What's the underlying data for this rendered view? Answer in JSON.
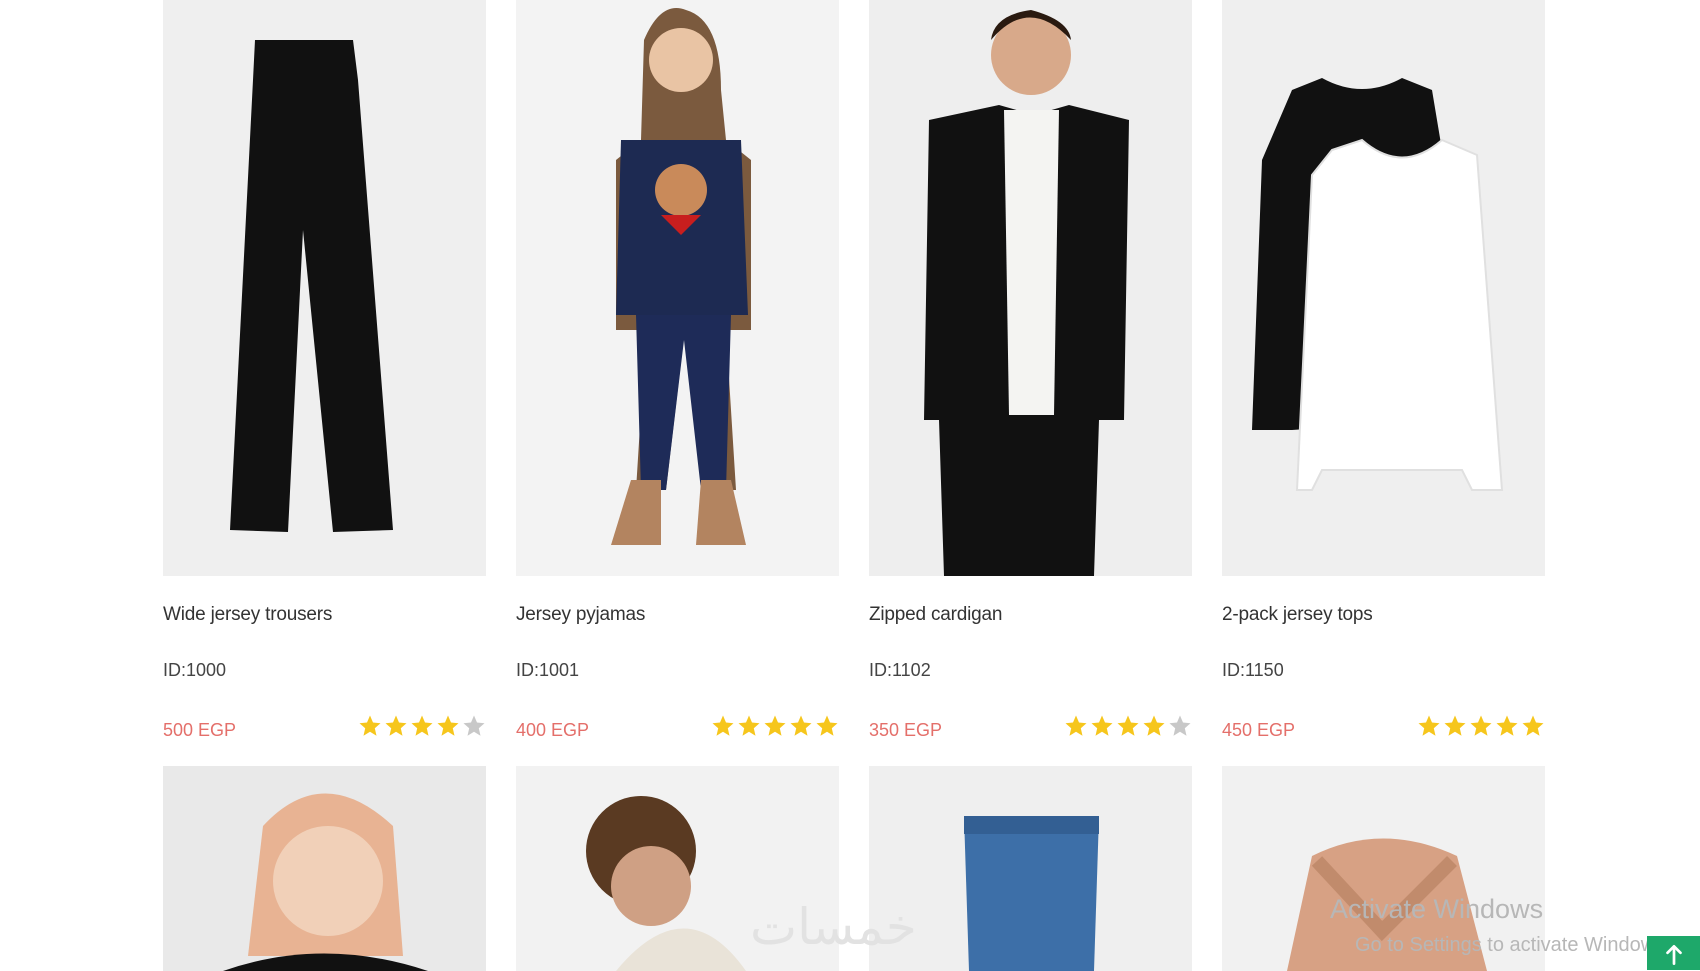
{
  "products_row1": [
    {
      "name": "Wide jersey trousers",
      "id": "ID:1000",
      "price": "500 EGP",
      "rating": 4
    },
    {
      "name": "Jersey pyjamas",
      "id": "ID:1001",
      "price": "400 EGP",
      "rating": 5
    },
    {
      "name": "Zipped cardigan",
      "id": "ID:1102",
      "price": "350 EGP",
      "rating": 4
    },
    {
      "name": "2-pack jersey tops",
      "id": "ID:1150",
      "price": "450 EGP",
      "rating": 5
    }
  ],
  "products_row2": [
    {
      "image": "girl-portrait"
    },
    {
      "image": "man-turtleneck"
    },
    {
      "image": "blue-jeans"
    },
    {
      "image": "pink-ruffle-top"
    }
  ],
  "watermark": {
    "logo_text": "خمسات",
    "line1": "Activate Windows",
    "line2": "Go to Settings to activate Windows."
  },
  "colors": {
    "price": "#e46f6a",
    "star_on": "#f6c61c",
    "star_off": "#c8c8c8",
    "scroll_top": "#1ea86a"
  },
  "icons": {
    "scroll_top": "arrow-up-icon",
    "rating": "star-icon"
  }
}
